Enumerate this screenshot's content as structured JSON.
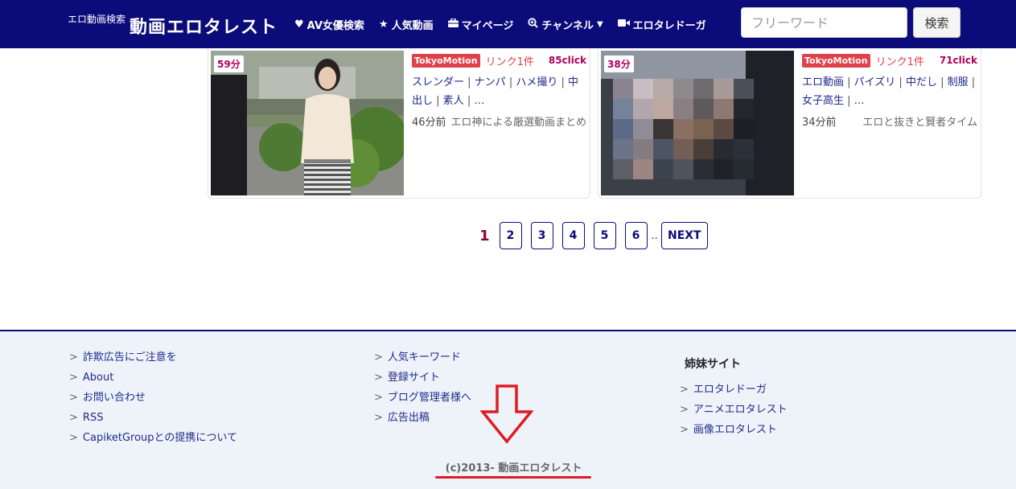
{
  "header": {
    "logo_small": "エロ動画検索",
    "logo_main": "動画エロタレスト",
    "nav": [
      {
        "label": "AV女優検索",
        "icon": "heart-icon"
      },
      {
        "label": "人気動画",
        "icon": "star-icon"
      },
      {
        "label": "マイページ",
        "icon": "briefcase-icon"
      },
      {
        "label": "チャンネル",
        "icon": "search-plus-icon"
      },
      {
        "label": "エロタレドーガ",
        "icon": "video-camera-icon"
      }
    ],
    "search_placeholder": "フリーワード",
    "search_button": "検索"
  },
  "cards": [
    {
      "duration": "59分",
      "source_badge": "TokyoMotion",
      "link_count": "リンク1件",
      "clicks": "85click",
      "tags": [
        "スレンダー",
        "ナンパ",
        "ハメ撮り",
        "中出し",
        "素人"
      ],
      "more": "…",
      "time_ago": "46分前",
      "source": "エロ神による厳選動画まとめ"
    },
    {
      "duration": "38分",
      "source_badge": "TokyoMotion",
      "link_count": "リンク1件",
      "clicks": "71click",
      "tags": [
        "エロ動画",
        "パイズリ",
        "中だし",
        "制服",
        "女子高生"
      ],
      "more": "…",
      "time_ago": "34分前",
      "source": "エロと抜きと賢者タイム"
    }
  ],
  "pagination": {
    "current": "1",
    "pages": [
      "2",
      "3",
      "4",
      "5",
      "6"
    ],
    "dots": "..",
    "next": "NEXT"
  },
  "footer": {
    "col1": [
      "詐欺広告にご注意を",
      "About",
      "お問い合わせ",
      "RSS",
      "CapiketGroupとの提携について"
    ],
    "col2": [
      "人気キーワード",
      "登録サイト",
      "ブログ管理者様へ",
      "広告出稿"
    ],
    "col3_title": "姉妹サイト",
    "col3": [
      "エロタレドーガ",
      "アニメエロタレスト",
      "画像エロタレスト"
    ],
    "arrow_marker": ">",
    "copyright": "(c)2013- 動画エロタレスト"
  },
  "colors": {
    "header_bg": "#0b0b7a",
    "accent_red": "#e0414a",
    "annotation_red": "#e01b24",
    "footer_bg": "#eef3fa"
  }
}
